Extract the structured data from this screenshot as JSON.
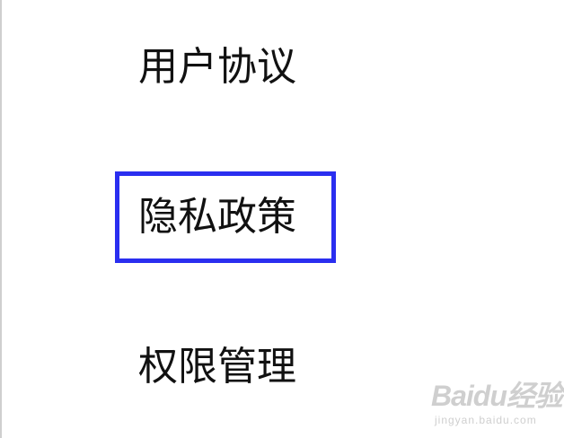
{
  "menu": {
    "items": [
      {
        "label": "用户协议"
      },
      {
        "label": "隐私政策",
        "highlighted": true
      },
      {
        "label": "权限管理"
      }
    ]
  },
  "highlight": {
    "color": "#2a2ef0"
  },
  "watermark": {
    "brand": "Baidu经验",
    "sub": "jingyan.baidu.com",
    "icon": "paw-icon"
  }
}
